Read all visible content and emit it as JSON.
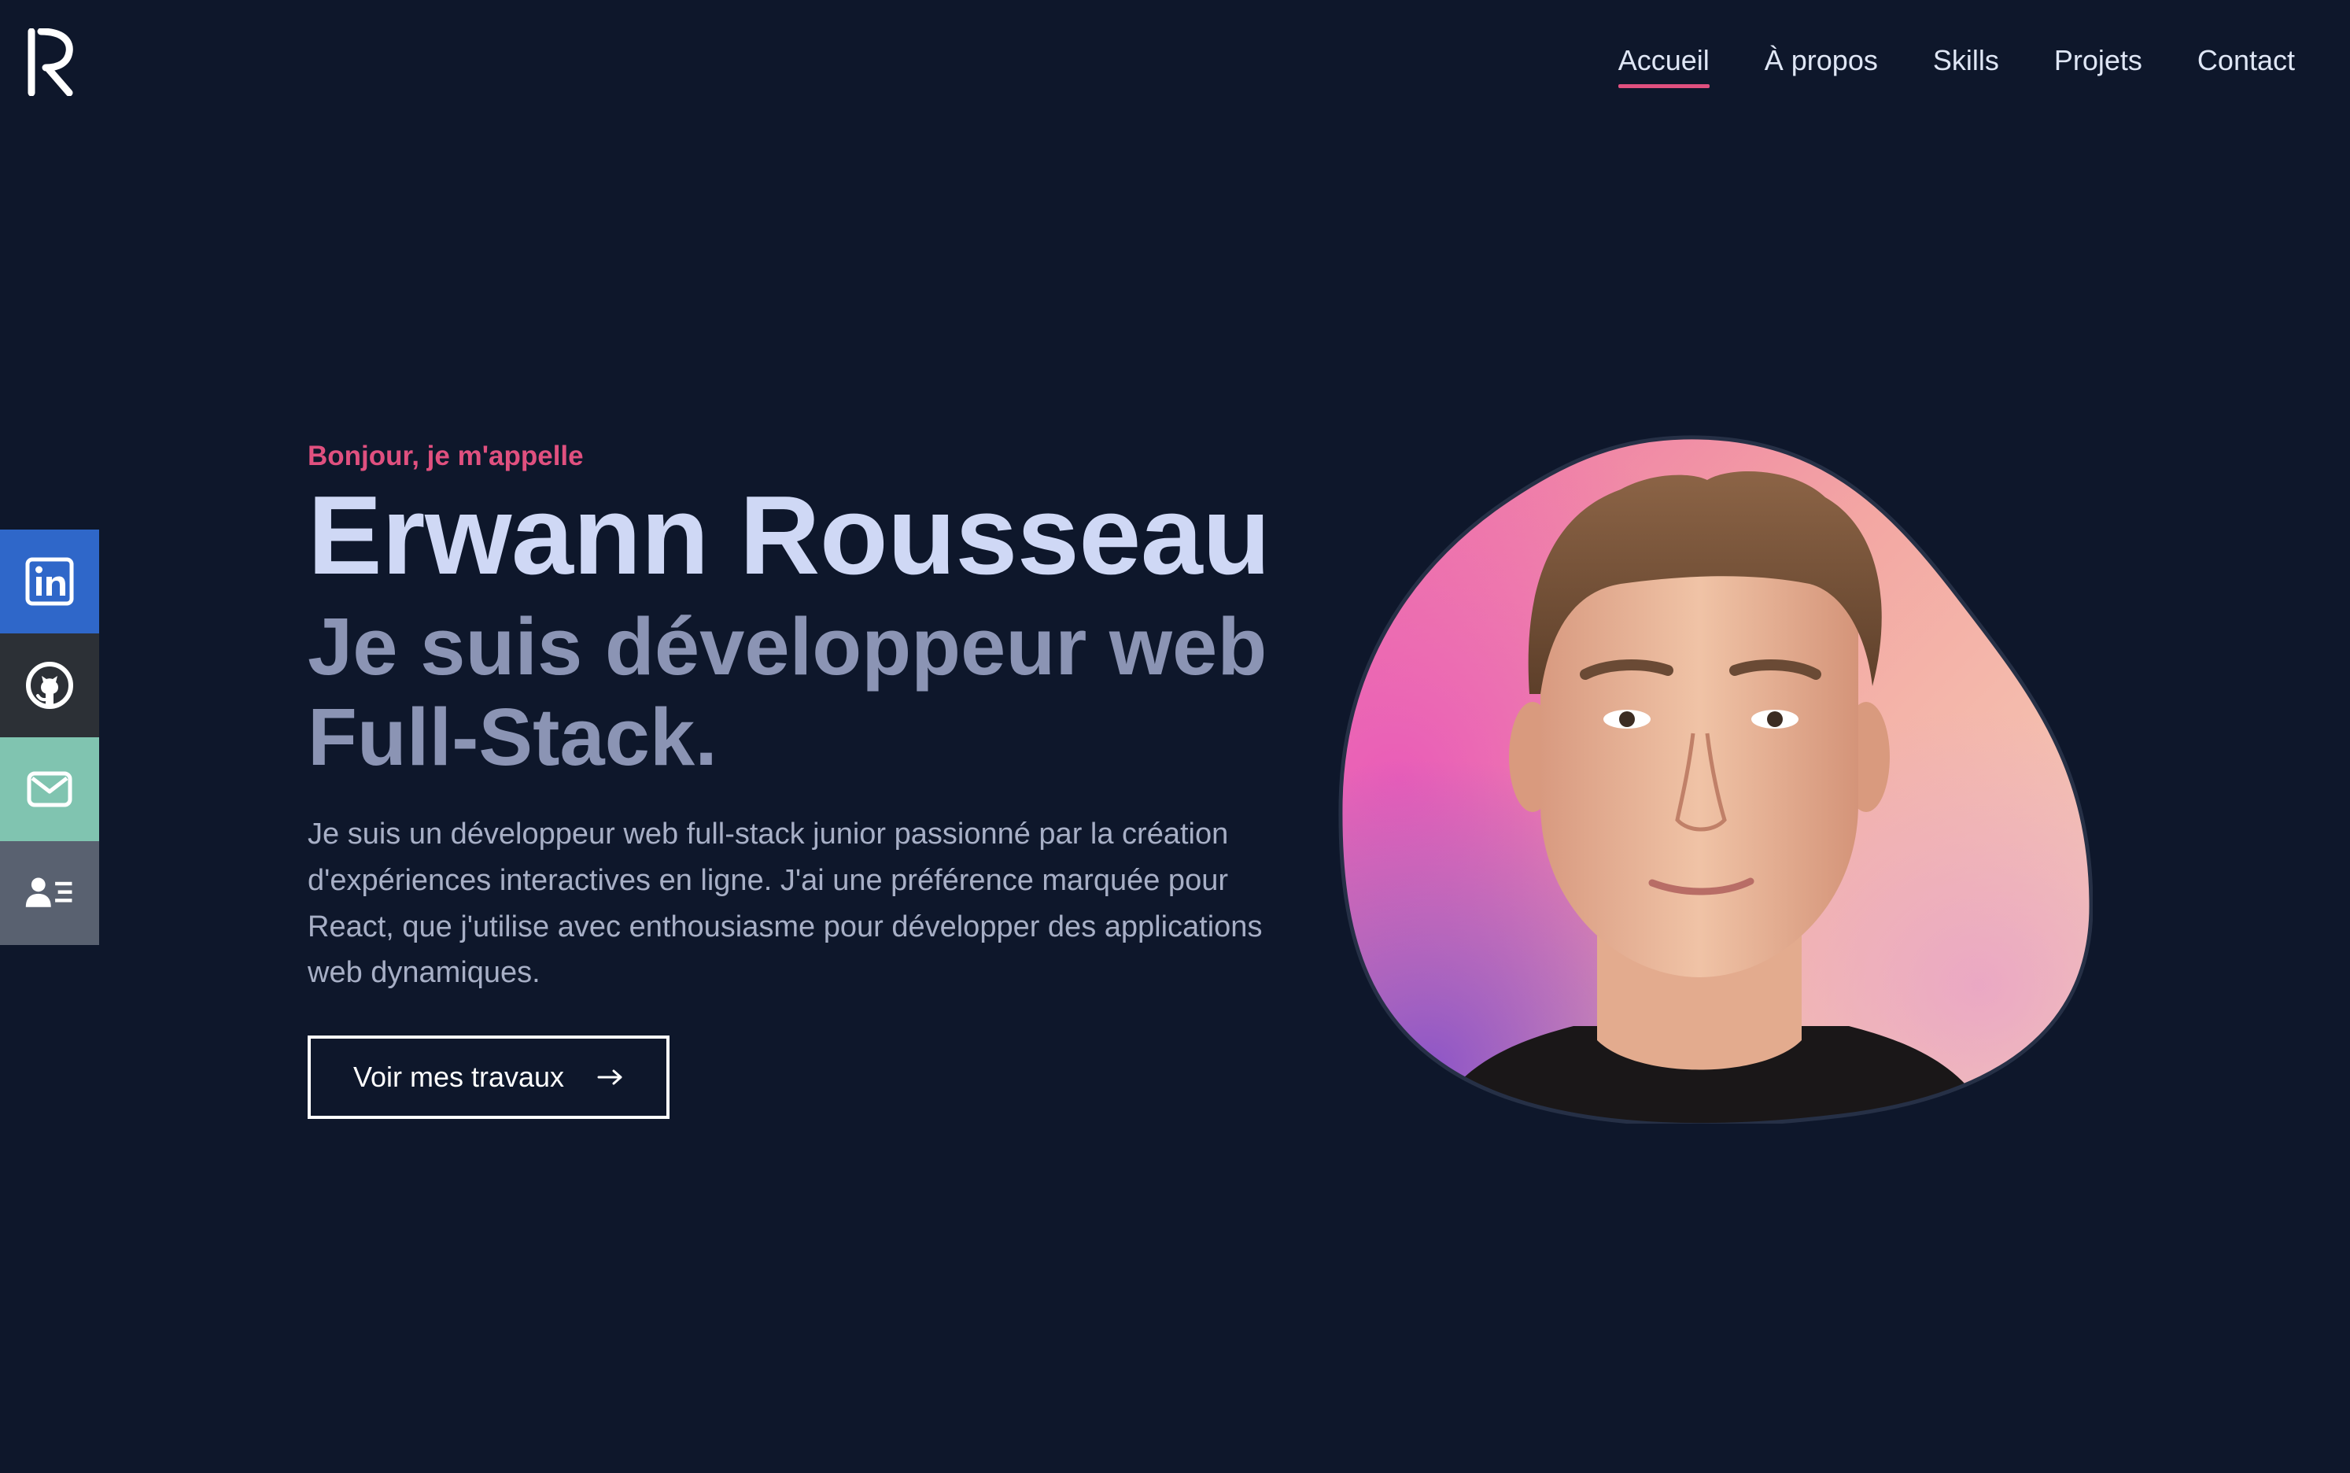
{
  "nav": {
    "items": [
      {
        "label": "Accueil",
        "active": true
      },
      {
        "label": "À propos",
        "active": false
      },
      {
        "label": "Skills",
        "active": false
      },
      {
        "label": "Projets",
        "active": false
      },
      {
        "label": "Contact",
        "active": false
      }
    ]
  },
  "logo": {
    "icon": "logo-r-icon"
  },
  "socials": [
    {
      "icon": "linkedin-icon",
      "color": "#2f67c9"
    },
    {
      "icon": "github-icon",
      "color": "#2c3036"
    },
    {
      "icon": "mail-icon",
      "color": "#80c4b0"
    },
    {
      "icon": "contact-card-icon",
      "color": "#596170"
    }
  ],
  "hero": {
    "greeting": "Bonjour, je m'appelle",
    "name": "Erwann Rousseau",
    "role_line1": "Je suis développeur web",
    "role_line2": "Full-Stack.",
    "description": "Je suis un développeur web full-stack junior passionné par la création d'expériences interactives en ligne. J'ai une préférence marquée pour React, que j'utilise avec enthousiasme pour développer des applications web dynamiques.",
    "cta_label": "Voir mes travaux",
    "cta_icon": "arrow-right-icon"
  },
  "colors": {
    "background": "#0e172b",
    "accent": "#e0507f",
    "name": "#cfd8f5",
    "role": "#8b94b4",
    "text": "#a7afc6"
  }
}
